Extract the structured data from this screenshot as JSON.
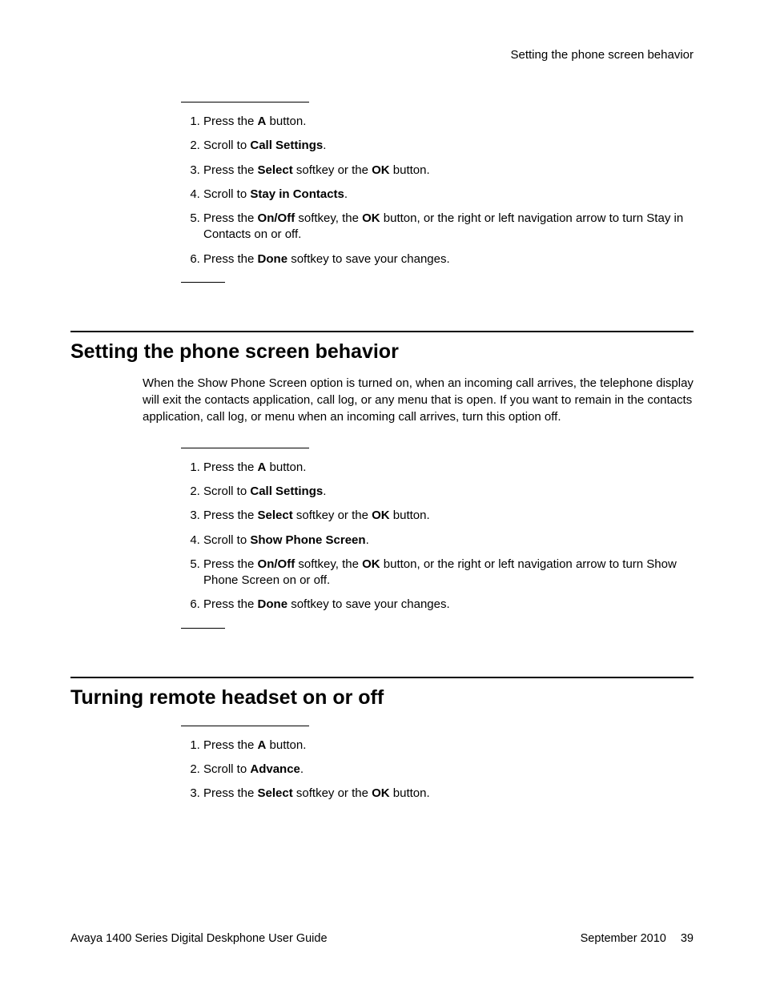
{
  "header": {
    "running_title": "Setting the phone screen behavior"
  },
  "sectionA": {
    "steps": [
      {
        "pre": "Press the ",
        "bold": "A",
        "post": " button."
      },
      {
        "pre": "Scroll to ",
        "bold": "Call Settings",
        "post": "."
      },
      {
        "pre": "Press the ",
        "bold": "Select",
        "mid": " softkey or the ",
        "bold2": "OK",
        "post": " button."
      },
      {
        "pre": "Scroll to ",
        "bold": "Stay in Contacts",
        "post": "."
      },
      {
        "pre": "Press the ",
        "bold": "On/Off",
        "mid": " softkey, the ",
        "bold2": "OK",
        "post": " button, or the right or left navigation arrow to turn Stay in Contacts on or off."
      },
      {
        "pre": "Press the ",
        "bold": "Done",
        "post": " softkey to save your changes."
      }
    ]
  },
  "sectionB": {
    "title": "Setting the phone screen behavior",
    "paragraph": "When the Show Phone Screen option is turned on, when an incoming call arrives, the telephone display will exit the contacts application, call log, or any menu that is open. If you want to remain in the contacts application, call log, or menu when an incoming call arrives, turn this option off.",
    "steps": [
      {
        "pre": "Press the ",
        "bold": "A",
        "post": " button."
      },
      {
        "pre": "Scroll to ",
        "bold": "Call Settings",
        "post": "."
      },
      {
        "pre": "Press the ",
        "bold": "Select",
        "mid": " softkey or the ",
        "bold2": "OK",
        "post": " button."
      },
      {
        "pre": "Scroll to ",
        "bold": "Show Phone Screen",
        "post": "."
      },
      {
        "pre": "Press the ",
        "bold": "On/Off",
        "mid": " softkey, the ",
        "bold2": "OK",
        "post": " button, or the right or left navigation arrow to turn Show Phone Screen on or off."
      },
      {
        "pre": "Press the ",
        "bold": "Done",
        "post": " softkey to save your changes."
      }
    ]
  },
  "sectionC": {
    "title": "Turning remote headset on or off",
    "steps": [
      {
        "pre": "Press the ",
        "bold": "A",
        "post": " button."
      },
      {
        "pre": "Scroll to ",
        "bold": "Advance",
        "post": "."
      },
      {
        "pre": "Press the ",
        "bold": "Select",
        "mid": " softkey or the ",
        "bold2": "OK",
        "post": " button."
      }
    ]
  },
  "footer": {
    "left": "Avaya 1400 Series Digital Deskphone User Guide",
    "date": "September 2010",
    "page": "39"
  }
}
